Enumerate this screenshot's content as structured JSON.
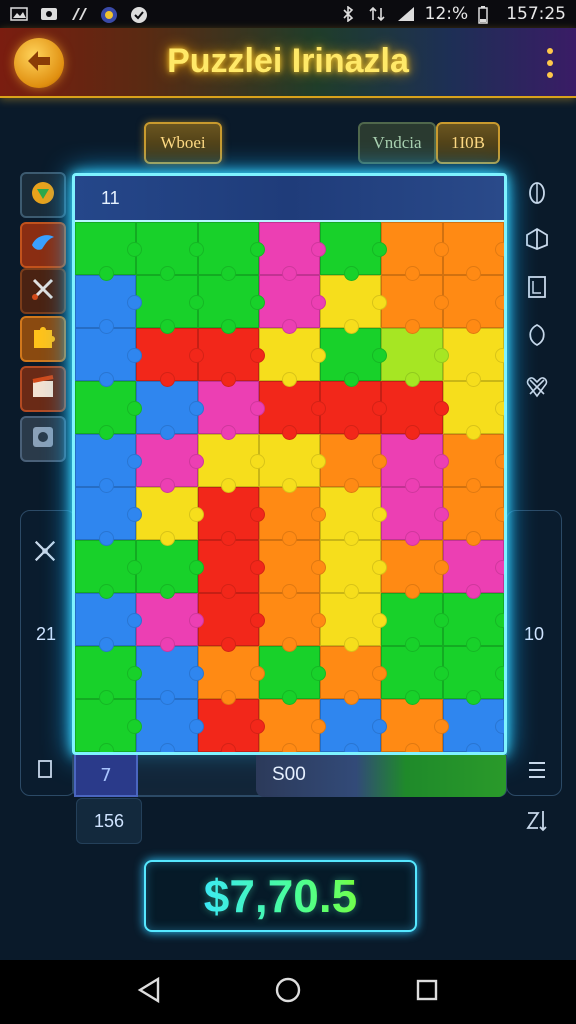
{
  "status_bar": {
    "battery": "12:%",
    "time": "157:25"
  },
  "header": {
    "title": "Puzzlei Irinazla"
  },
  "chips": {
    "left": "Wboei",
    "mid": "Vndcia",
    "right": "1I0B"
  },
  "board": {
    "top_count": "11",
    "colors": {
      "G": "#18d12a",
      "B": "#2f86ef",
      "R": "#f2271a",
      "O": "#ff8a14",
      "Y": "#f6de1c",
      "M": "#ec3fb3",
      "L": "#a6e623",
      "P": "#c445d0"
    },
    "rows": [
      [
        "G",
        "G",
        "G",
        "M",
        "G",
        "O",
        "O"
      ],
      [
        "B",
        "G",
        "G",
        "M",
        "Y",
        "O",
        "O"
      ],
      [
        "B",
        "R",
        "R",
        "Y",
        "G",
        "L",
        "Y"
      ],
      [
        "G",
        "B",
        "M",
        "R",
        "R",
        "R",
        "Y"
      ],
      [
        "B",
        "M",
        "Y",
        "Y",
        "O",
        "M",
        "O"
      ],
      [
        "B",
        "Y",
        "R",
        "O",
        "Y",
        "M",
        "O"
      ],
      [
        "G",
        "G",
        "R",
        "O",
        "Y",
        "O",
        "M"
      ],
      [
        "B",
        "M",
        "R",
        "O",
        "Y",
        "G",
        "G"
      ],
      [
        "G",
        "B",
        "O",
        "G",
        "O",
        "G",
        "G"
      ],
      [
        "G",
        "B",
        "R",
        "O",
        "B",
        "O",
        "B"
      ]
    ]
  },
  "side": {
    "left_number": "21",
    "right_number": "10"
  },
  "tray": {
    "left_value": "7",
    "score": "S00",
    "bottom_left_value": "156"
  },
  "money": {
    "value": "$7,70.5"
  }
}
